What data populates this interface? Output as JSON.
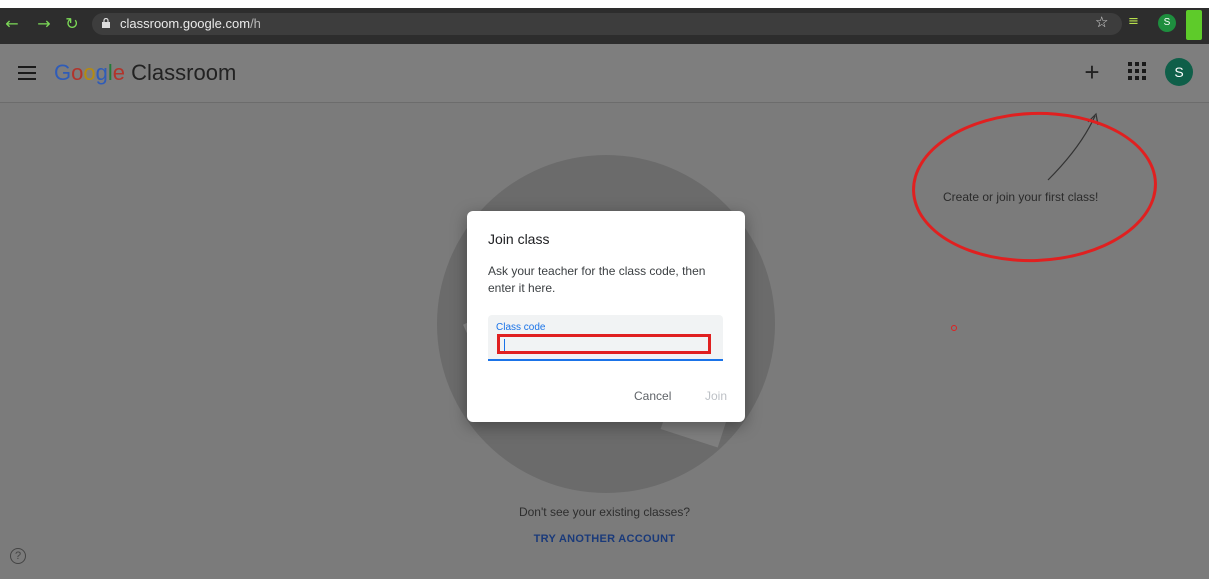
{
  "browser": {
    "url_host": "classroom.google.com",
    "url_path": "/h",
    "back_icon": "arrow-left-icon",
    "forward_icon": "arrow-right-icon",
    "reload_icon": "reload-icon",
    "profile_initial": "S"
  },
  "header": {
    "logo_google": "Google",
    "logo_product": "Classroom",
    "plus_label": "+",
    "avatar_initial": "S"
  },
  "hint": {
    "text": "Create or join your first class!"
  },
  "dialog": {
    "title": "Join class",
    "body": "Ask your teacher for the class code, then enter it here.",
    "field_label": "Class code",
    "field_value": "",
    "cancel_label": "Cancel",
    "join_label": "Join"
  },
  "footer": {
    "question": "Don't see your existing classes?",
    "link": "TRY ANOTHER ACCOUNT",
    "help_label": "?"
  },
  "colors": {
    "annotation_red": "#e02020",
    "accent_blue": "#1a73e8",
    "avatar_green": "#0f5f49"
  }
}
